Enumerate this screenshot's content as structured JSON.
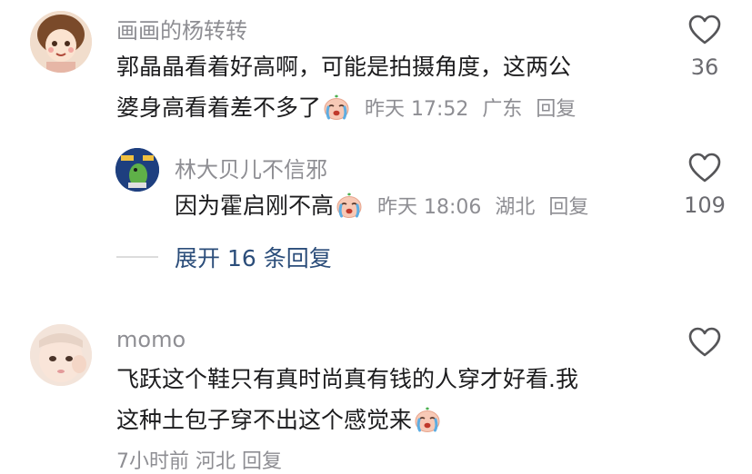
{
  "comments": [
    {
      "username": "画画的杨转转",
      "lines": [
        "郭晶晶看着好高啊，可能是拍摄角度，这两公",
        "婆身高看着差不多了"
      ],
      "emoji": "crying-emoji",
      "time": "昨天 17:52",
      "location": "广东",
      "reply_label": "回复",
      "likes": "36",
      "replies": [
        {
          "username": "林大贝儿不信邪",
          "text": "因为霍启刚不高",
          "emoji": "crying-emoji",
          "time": "昨天 18:06",
          "location": "湖北",
          "reply_label": "回复",
          "likes": "109"
        }
      ],
      "expand_label": "展开 16 条回复"
    },
    {
      "username": "momo",
      "lines": [
        "飞跃这个鞋只有真时尚真有钱的人穿才好看.我",
        "这种土包子穿不出这个感觉来"
      ],
      "emoji": "crying-emoji",
      "meta_partial": "7小时前 河北 回复"
    }
  ],
  "colors": {
    "username": "#8e8e93",
    "text": "#1c1c1e",
    "link": "#2b4d7a",
    "icon": "#6b6b70"
  }
}
